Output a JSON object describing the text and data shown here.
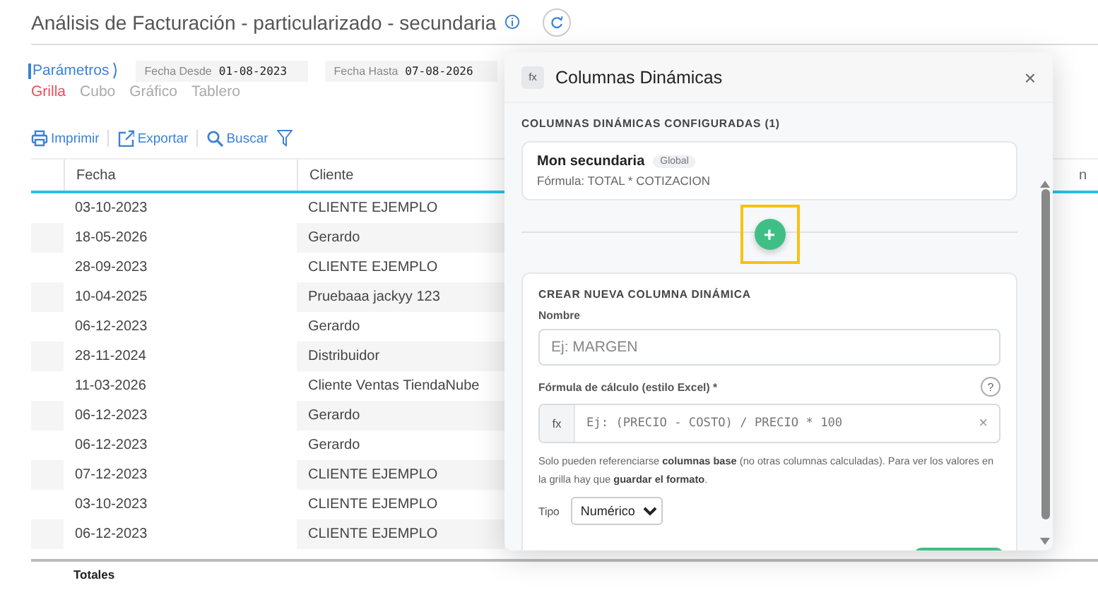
{
  "page": {
    "title": "Análisis de Facturación - particularizado - secundaria"
  },
  "filters": {
    "params_label": "Parámetros",
    "date_from": {
      "label": "Fecha Desde",
      "value": "01-08-2023"
    },
    "date_to": {
      "label": "Fecha Hasta",
      "value": "07-08-2026"
    }
  },
  "view_tabs": [
    {
      "label": "Grilla",
      "selected": true
    },
    {
      "label": "Cubo",
      "selected": false
    },
    {
      "label": "Gráfico",
      "selected": false
    },
    {
      "label": "Tablero",
      "selected": false
    }
  ],
  "toolbar": [
    {
      "label": "Imprimir",
      "kind": "print"
    },
    {
      "label": "Exportar",
      "kind": "export"
    },
    {
      "label": "Buscar",
      "kind": "search"
    }
  ],
  "table": {
    "columns": [
      "Fecha",
      "Cliente",
      "n"
    ],
    "rows": [
      {
        "fecha": "03-10-2023",
        "cliente": "CLIENTE EJEMPLO"
      },
      {
        "fecha": "18-05-2026",
        "cliente": "Gerardo"
      },
      {
        "fecha": "28-09-2023",
        "cliente": "CLIENTE EJEMPLO"
      },
      {
        "fecha": "10-04-2025",
        "cliente": "Pruebaaa jackyy 123"
      },
      {
        "fecha": "06-12-2023",
        "cliente": "Gerardo"
      },
      {
        "fecha": "28-11-2024",
        "cliente": "Distribuidor"
      },
      {
        "fecha": "11-03-2026",
        "cliente": "Cliente Ventas TiendaNube"
      },
      {
        "fecha": "06-12-2023",
        "cliente": "Gerardo"
      },
      {
        "fecha": "06-12-2023",
        "cliente": "Gerardo"
      },
      {
        "fecha": "07-12-2023",
        "cliente": "CLIENTE EJEMPLO"
      },
      {
        "fecha": "03-10-2023",
        "cliente": "CLIENTE EJEMPLO"
      },
      {
        "fecha": "06-12-2023",
        "cliente": "CLIENTE EJEMPLO"
      }
    ],
    "totals_label": "Totales"
  },
  "dialog": {
    "icon_text": "fx",
    "title": "Columnas Dinámicas",
    "close": "×",
    "configured_heading": "COLUMNAS DINÁMICAS CONFIGURADAS (1)",
    "configured": [
      {
        "name": "Mon secundaria",
        "scope": "Global",
        "formula": "Fórmula: TOTAL * COTIZACION"
      }
    ],
    "add_button": {
      "label": "+",
      "highlighted": true
    },
    "create": {
      "heading": "CREAR NUEVA COLUMNA DINÁMICA",
      "name_label": "Nombre",
      "name_placeholder": "Ej: MARGEN",
      "formula_label": "Fórmula de cálculo (estilo Excel) *",
      "help_icon": "?",
      "formula_prefix": "fx",
      "formula_placeholder": "Ej: (PRECIO - COSTO) / PRECIO * 100",
      "clear": "×",
      "help": "Solo pueden referenciarse **columnas base** (no otras columnas calculadas). Para ver los valores en la grilla hay que **guardar el formato**.",
      "type_label": "Tipo",
      "type_value": "Numérico"
    }
  }
}
